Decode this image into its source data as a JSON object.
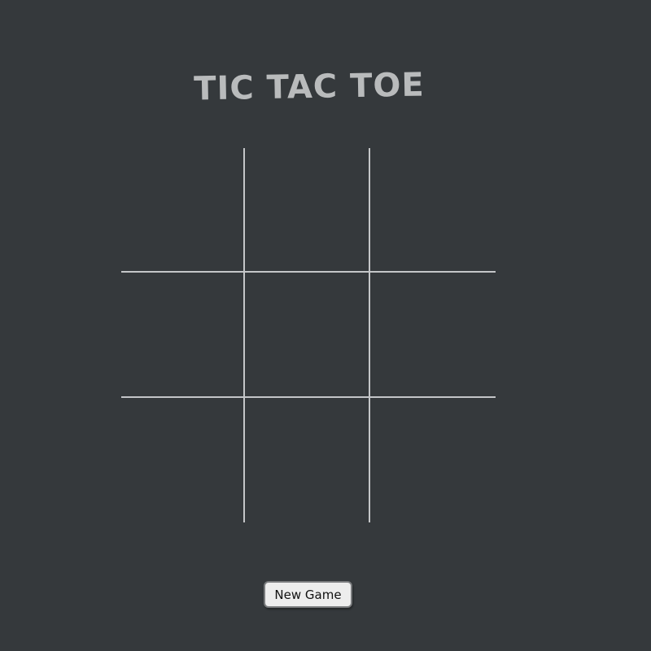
{
  "title": "TIC TAC TOE",
  "board": {
    "rows": 3,
    "cols": 3,
    "cells": [
      "",
      "",
      "",
      "",
      "",
      "",
      "",
      "",
      ""
    ]
  },
  "new_game_label": "New Game",
  "colors": {
    "background": "#35393c",
    "grid_line": "#c4c6c8",
    "title": "#b9bbbc",
    "button_bg": "#ededed"
  }
}
